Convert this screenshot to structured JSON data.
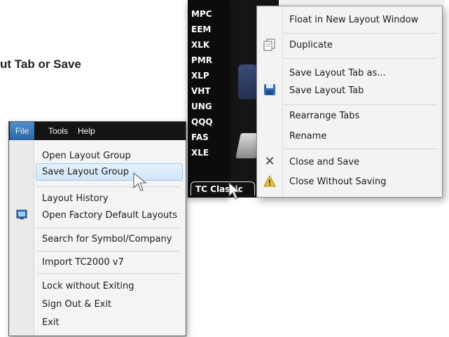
{
  "heading": "ut Tab or Save",
  "symbols": [
    "MPC",
    "EEM",
    "XLK",
    "PMR",
    "XLP",
    "VHT",
    "UNG",
    "QQQ",
    "FAS",
    "XLE"
  ],
  "tab_label": "TC Classic",
  "context_menu": {
    "items": [
      {
        "label": "Float in New Layout Window",
        "icon": ""
      },
      {
        "label": "Duplicate",
        "icon": "duplicate-icon"
      },
      {
        "label": "Save Layout Tab as...",
        "icon": ""
      },
      {
        "label": "Save Layout Tab",
        "icon": "floppy-disk-icon"
      },
      {
        "label": "Rearrange Tabs",
        "icon": ""
      },
      {
        "label": "Rename",
        "icon": ""
      },
      {
        "label": "Close and Save",
        "icon": "close-x-icon"
      },
      {
        "label": "Close Without Saving",
        "icon": "warning-icon"
      }
    ]
  },
  "file_menu": {
    "menubar": [
      "File",
      "Tools",
      "Help"
    ],
    "items": [
      "Open Layout Group",
      "Save Layout Group",
      "Layout History",
      "Open Factory Default Layouts",
      "Search for Symbol/Company",
      "Import TC2000 v7",
      "Lock without Exiting",
      "Sign Out & Exit",
      "Exit"
    ],
    "highlighted": "Save Layout Group"
  },
  "colors": {
    "menubar": "#141414",
    "file_active": "#2a66a6",
    "highlight": "#cfe6f7"
  }
}
